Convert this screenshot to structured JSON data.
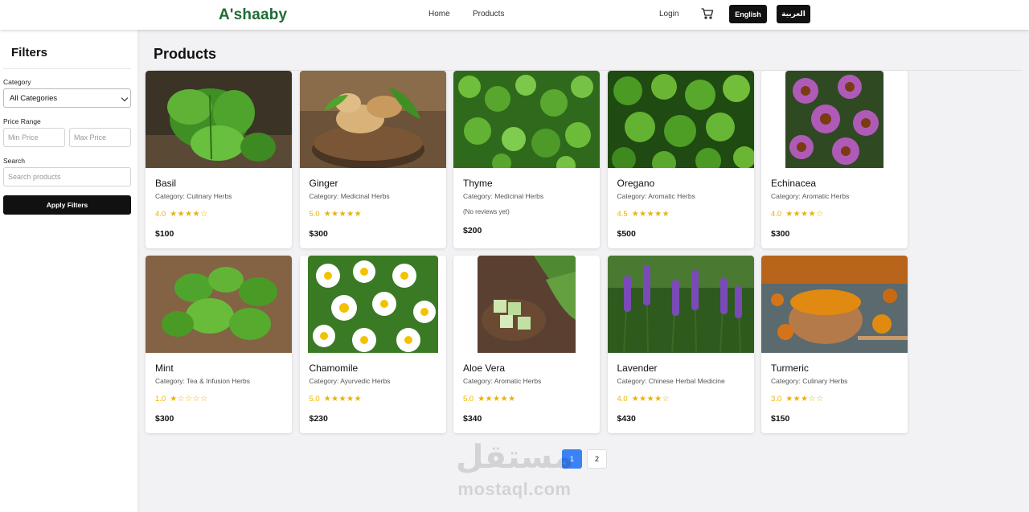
{
  "header": {
    "logo": "A'shaaby",
    "nav": {
      "home": "Home",
      "products": "Products",
      "login": "Login"
    },
    "cart_icon": "cart-icon",
    "lang_en": "English",
    "lang_ar": "العربية"
  },
  "sidebar": {
    "title": "Filters",
    "category_label": "Category",
    "category_value": "All Categories",
    "price_label": "Price Range",
    "min_placeholder": "Min Price",
    "max_placeholder": "Max Price",
    "search_label": "Search",
    "search_placeholder": "Search products",
    "apply_label": "Apply Filters"
  },
  "main": {
    "title": "Products",
    "products": [
      {
        "name": "Basil",
        "category": "Category: Culinary Herbs",
        "rating": "4.0",
        "stars": 4,
        "price": "$100",
        "reviews": ""
      },
      {
        "name": "Ginger",
        "category": "Category: Medicinal Herbs",
        "rating": "5.0",
        "stars": 5,
        "price": "$300",
        "reviews": ""
      },
      {
        "name": "Thyme",
        "category": "Category: Medicinal Herbs",
        "rating": "",
        "stars": 0,
        "price": "$200",
        "reviews": "(No reviews yet)"
      },
      {
        "name": "Oregano",
        "category": "Category: Aromatic Herbs",
        "rating": "4.5",
        "stars": 5,
        "price": "$500",
        "reviews": ""
      },
      {
        "name": "Echinacea",
        "category": "Category: Aromatic Herbs",
        "rating": "4.0",
        "stars": 4,
        "price": "$300",
        "reviews": ""
      },
      {
        "name": "Mint",
        "category": "Category: Tea & Infusion Herbs",
        "rating": "1.0",
        "stars": 1,
        "price": "$300",
        "reviews": ""
      },
      {
        "name": "Chamomile",
        "category": "Category: Ayurvedic Herbs",
        "rating": "5.0",
        "stars": 5,
        "price": "$230",
        "reviews": ""
      },
      {
        "name": "Aloe Vera",
        "category": "Category: Aromatic Herbs",
        "rating": "5.0",
        "stars": 5,
        "price": "$340",
        "reviews": ""
      },
      {
        "name": "Lavender",
        "category": "Category: Chinese Herbal Medicine",
        "rating": "4.0",
        "stars": 4,
        "price": "$430",
        "reviews": ""
      },
      {
        "name": "Turmeric",
        "category": "Category: Culinary Herbs",
        "rating": "3.0",
        "stars": 3,
        "price": "$150",
        "reviews": ""
      }
    ]
  },
  "pagination": {
    "page1": "1",
    "page2": "2"
  },
  "watermark": {
    "arabic": "مستقل",
    "latin": "mostaql.com"
  },
  "colors": {
    "brand": "#1f6b35",
    "star": "#eab308",
    "active_page": "#3b82f6",
    "button": "#111111"
  }
}
